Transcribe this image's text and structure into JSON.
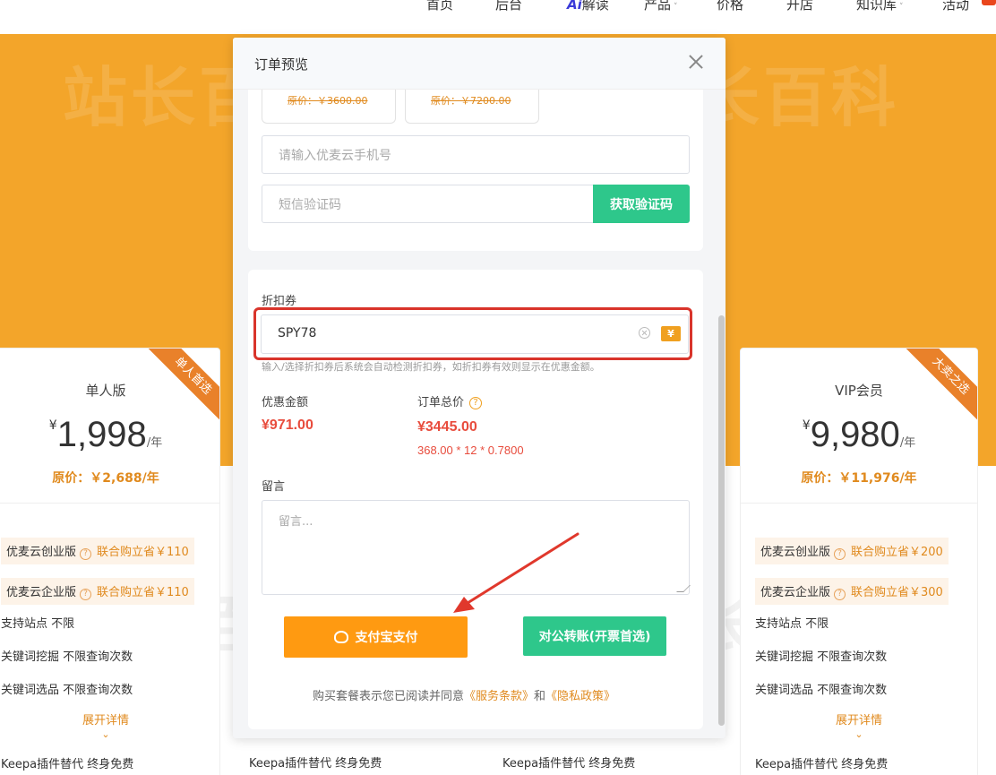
{
  "nav": {
    "items": [
      {
        "label": "首页"
      },
      {
        "label": "后台"
      },
      {
        "ai": "Ai",
        "label": "解读"
      },
      {
        "label": "产品",
        "caret": "˅"
      },
      {
        "label": "价格"
      },
      {
        "label": "开店"
      },
      {
        "label": "知识库",
        "caret": "˅"
      },
      {
        "label": "活动"
      }
    ]
  },
  "cards": {
    "left": {
      "ribbon": "单人首选",
      "name": "单人版",
      "currency": "¥",
      "price": "1,998",
      "unit": "/年",
      "original": "原价：￥2,688/年",
      "features": [
        {
          "name": "优麦云创业版",
          "help": "?",
          "save": "联合购立省￥110"
        },
        {
          "name": "优麦云企业版",
          "help": "?",
          "save": "联合购立省￥110"
        }
      ],
      "items": [
        "支持站点  不限",
        "关键词挖掘  不限查询次数",
        "关键词选品  不限查询次数"
      ],
      "more": "展开详情",
      "chevron": "⌄",
      "keepa": "Keepa插件替代  终身免费"
    },
    "right": {
      "ribbon": "大卖之选",
      "name": "VIP会员",
      "currency": "¥",
      "price": "9,980",
      "unit": "/年",
      "original": "原价：￥11,976/年",
      "features": [
        {
          "name": "优麦云创业版",
          "help": "?",
          "save": "联合购立省￥200"
        },
        {
          "name": "优麦云企业版",
          "help": "?",
          "save": "联合购立省￥300"
        }
      ],
      "items": [
        "支持站点  不限",
        "关键词挖掘  不限查询次数",
        "关键词选品  不限查询次数"
      ],
      "more": "展开详情",
      "chevron": "⌄",
      "keepa": "Keepa插件替代  终身免费"
    },
    "mid_keepa_1": "Keepa插件替代  终身免费",
    "mid_keepa_2": "Keepa插件替代  终身免费"
  },
  "modal": {
    "title": "订单预览",
    "plans": [
      "原价：￥3600.00",
      "原价：￥7200.00"
    ],
    "phone_placeholder": "请输入优麦云手机号",
    "sms_placeholder": "短信验证码",
    "get_code_label": "获取验证码",
    "coupon_label": "折扣券",
    "coupon_value": "SPY78",
    "coupon_icon": "¥",
    "coupon_hint": "输入/选择折扣券后系统会自动检测折扣券，如折扣券有效则显示在优惠金额。",
    "discount_label": "优惠金额",
    "discount_value": "¥971.00",
    "total_label": "订单总价",
    "total_help": "?",
    "total_value": "¥3445.00",
    "total_calc": "368.00 * 12 * 0.7800",
    "message_label": "留言",
    "message_placeholder": "留言...",
    "pay_alipay_label": "支付宝支付",
    "pay_transfer_label": "对公转账(开票首选)",
    "agree_prefix": "购买套餐表示您已阅读并同意",
    "terms_link": "《服务条款》",
    "agree_and": "和",
    "privacy_link": "《隐私政策》"
  },
  "watermark": "站长百科",
  "colors": {
    "hero_orange": "#f3a52a",
    "accent_orange": "#ff9a11",
    "green": "#2ec78b",
    "price_red": "#e84c3d",
    "highlight_red": "#d9342b"
  }
}
